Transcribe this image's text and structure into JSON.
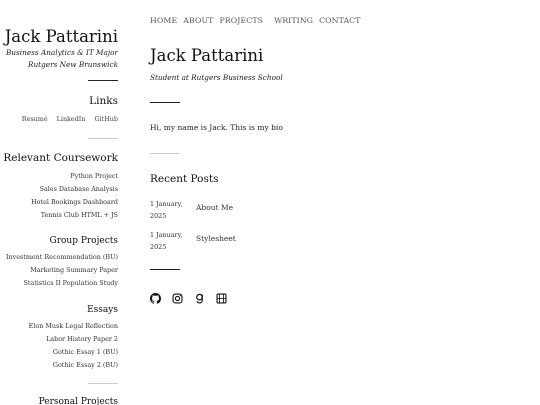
{
  "sidebar": {
    "title": "Jack Pattarini",
    "subtitle_line1": "Business Analytics & IT Major",
    "subtitle_line2": "Rutgers New Brunswick",
    "links_title": "Links",
    "links": [
      "Resumé",
      "LinkedIn",
      "GitHub"
    ],
    "coursework_title": "Relevant Coursework",
    "coursework": [
      "Python Project",
      "Sales Database Analysis",
      "Hotel Bookings Dashboard",
      "Tennis Club HTML + JS"
    ],
    "group_title": "Group Projects",
    "group_projects": [
      "Investment Recommendation (BU)",
      "Marketing Summary Paper",
      "Statistics II Population Study"
    ],
    "essays_title": "Essays",
    "essays": [
      "Elon Musk Legal Reflection",
      "Labor History Paper 2",
      "Gothic Essay 1 (BU)",
      "Gothic Essay 2 (BU)"
    ],
    "personal_title": "Personal Projects"
  },
  "nav": {
    "items": [
      "HOME",
      "ABOUT",
      "PROJECTS",
      "WRITING",
      "CONTACT"
    ]
  },
  "main": {
    "title": "Jack Pattarini",
    "subtitle": "Student at Rutgers Business School",
    "bio": "Hi, my name is Jack. This is my bio",
    "recent_posts_title": "Recent Posts",
    "posts": [
      {
        "date_line1": "1 January,",
        "date_line2": "2025",
        "title": "About Me"
      },
      {
        "date_line1": "1 January,",
        "date_line2": "2025",
        "title": "Stylesheet"
      }
    ]
  },
  "socials": [
    "github-icon",
    "instagram-icon",
    "goodreads-icon",
    "letterboxd-icon"
  ]
}
